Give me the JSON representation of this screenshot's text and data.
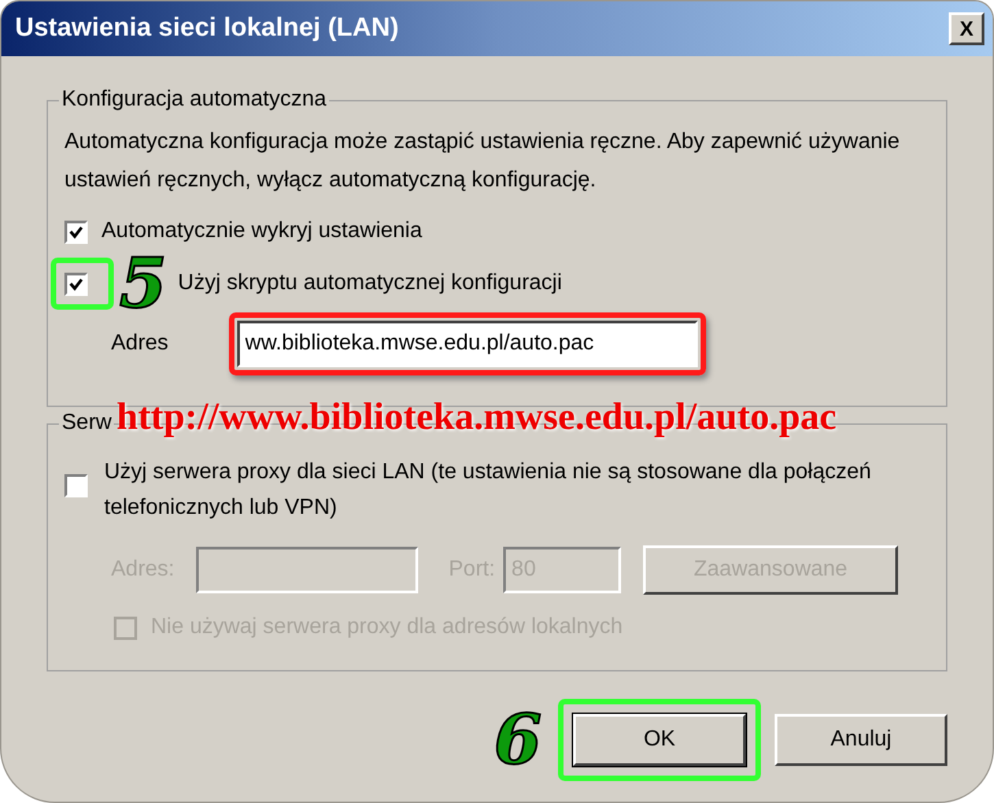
{
  "window": {
    "title": "Ustawienia sieci lokalnej (LAN)",
    "close": "X"
  },
  "auto_group": {
    "label": "Konfiguracja automatyczna",
    "description": "Automatyczna konfiguracja może zastąpić ustawienia ręczne. Aby zapewnić używanie ustawień ręcznych, wyłącz automatyczną konfigurację.",
    "options": [
      {
        "label": "Automatycznie wykryj ustawienia",
        "checked": true
      },
      {
        "label": "Użyj skryptu automatycznej konfiguracji",
        "checked": true
      }
    ],
    "address": {
      "label": "Adres",
      "value": "ww.biblioteka.mwse.edu.pl/auto.pac"
    }
  },
  "proxy_group": {
    "label": "Serw",
    "use_proxy": {
      "label": "Użyj serwera proxy dla sieci LAN (te ustawienia nie są stosowane dla połączeń telefonicznych lub VPN)",
      "checked": false
    },
    "address": {
      "label": "Adres:",
      "disabled": true
    },
    "port": {
      "label": "Port:",
      "value": "80",
      "disabled": true
    },
    "advanced": {
      "label": "Zaawansowane",
      "disabled": true
    },
    "bypass": {
      "label": "Nie używaj serwera proxy dla adresów lokalnych",
      "checked": false,
      "disabled": true
    }
  },
  "buttons": [
    {
      "label": "OK",
      "default": true
    },
    {
      "label": "Anuluj",
      "default": false
    }
  ],
  "annotations": [
    {
      "kind": "step",
      "text": "5"
    },
    {
      "kind": "url",
      "text": "http://www.biblioteka.mwse.edu.pl/auto.pac"
    },
    {
      "kind": "step",
      "text": "6"
    }
  ]
}
